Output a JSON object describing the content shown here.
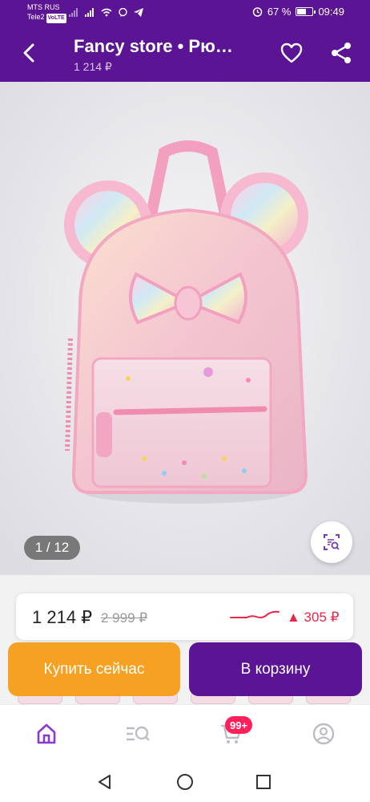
{
  "status_bar": {
    "carrier1": "MTS RUS",
    "carrier2": "Tele2",
    "volte": "VoLTE",
    "battery_percent": "67 %",
    "battery_level": 0.67,
    "time": "09:49"
  },
  "app_bar": {
    "title": "Fancy store • Рю…",
    "subtitle": "1 214 ₽"
  },
  "gallery": {
    "counter": "1 / 12"
  },
  "price": {
    "current": "1 214 ₽",
    "old": "2 999 ₽",
    "change": "▲ 305 ₽"
  },
  "actions": {
    "buy_now": "Купить сейчас",
    "add_to_cart": "В корзину"
  },
  "bottom_nav": {
    "cart_badge": "99+"
  },
  "colors": {
    "brand": "#5b1494",
    "buy": "#f6a122",
    "alert": "#e8274a",
    "badge": "#ff1f5a"
  }
}
